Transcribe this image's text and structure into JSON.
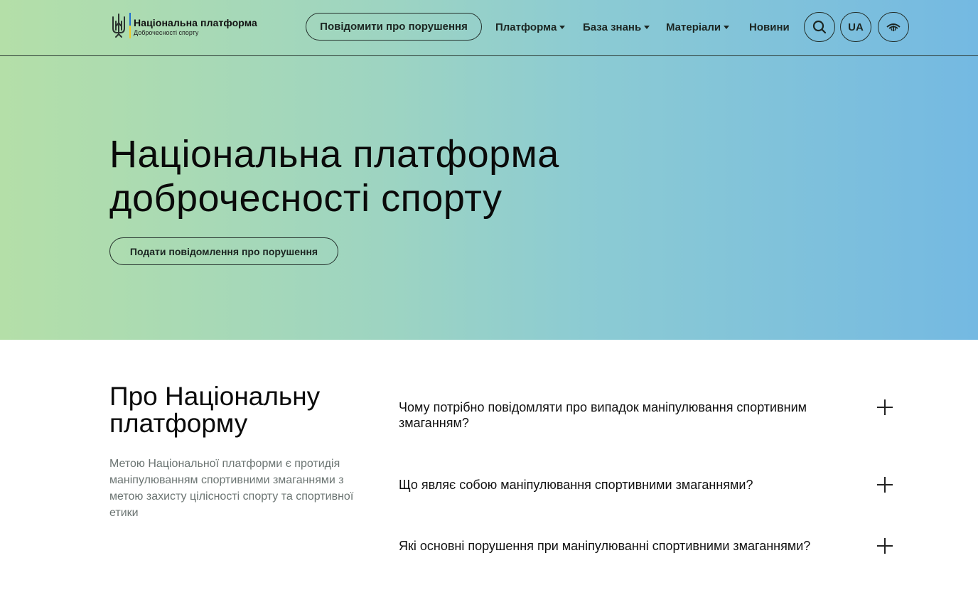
{
  "header": {
    "logo_title": "Національна платформа",
    "logo_subtitle": "Доброчесності спорту",
    "report_button": "Повідомити про порушення",
    "nav": [
      {
        "label": "Платформа",
        "dropdown": true
      },
      {
        "label": "База знань",
        "dropdown": true
      },
      {
        "label": "Матеріали",
        "dropdown": true
      },
      {
        "label": "Новини",
        "dropdown": false
      }
    ],
    "search_icon": "search-icon",
    "language": "UA",
    "accessibility_icon": "eye-accessibility-icon"
  },
  "hero": {
    "title_line1": "Національна платформа",
    "title_line2": "доброчесності спорту",
    "button": "Подати повідомлення про порушення"
  },
  "about": {
    "title_line1": "Про Національну",
    "title_line2": "платформу",
    "text": "Метою Національної платформи є протидія маніпулюванням спортивними змаганнями з метою захисту цілісності спорту та спортивної етики"
  },
  "faq": [
    {
      "question": "Чому потрібно повідомляти про випадок маніпулювання спортивним змаганням?"
    },
    {
      "question": "Що являє собою маніпулювання спортивними змаганнями?"
    },
    {
      "question": "Які основні порушення при маніпулюванні спортивними змаганнями?"
    }
  ],
  "colors": {
    "gradient_start": "#b4dfa8",
    "gradient_end": "#74b9e2",
    "text_dark": "#0a0a0a",
    "text_muted": "#6b7472"
  }
}
